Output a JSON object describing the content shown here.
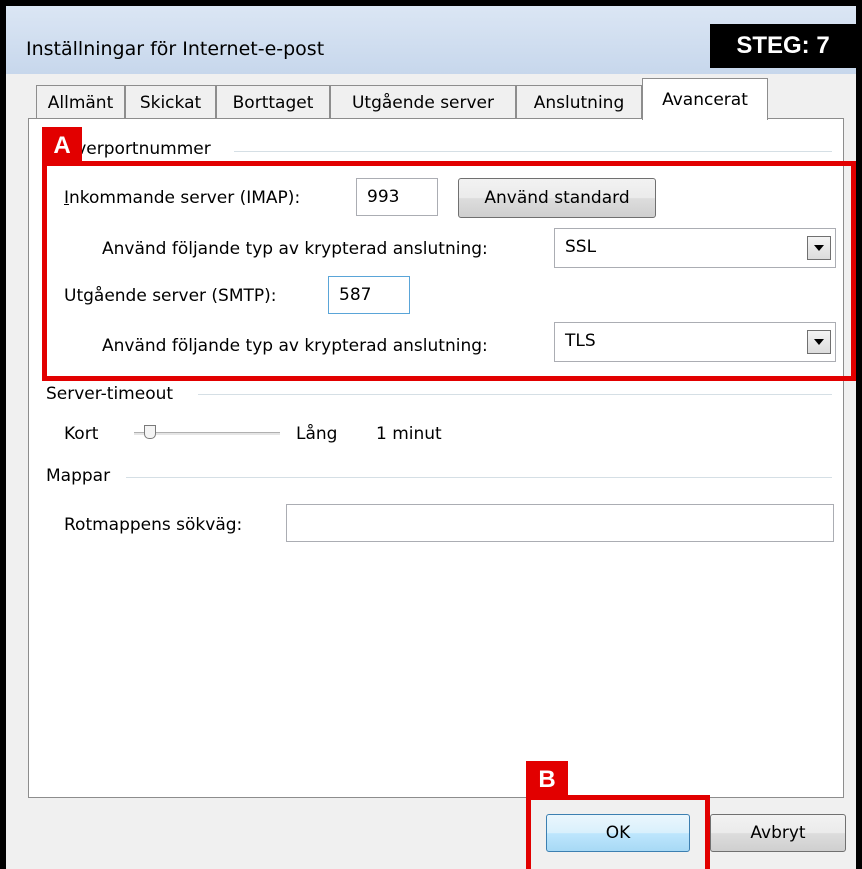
{
  "window": {
    "title": "Inställningar för Internet-e-post",
    "step_badge": "STEG: 7"
  },
  "tabs": [
    {
      "label": "Allmänt",
      "active": false
    },
    {
      "label": "Skickat",
      "active": false
    },
    {
      "label": "Borttaget",
      "active": false
    },
    {
      "label": "Utgående server",
      "active": false
    },
    {
      "label": "Anslutning",
      "active": false
    },
    {
      "label": "Avancerat",
      "active": true
    }
  ],
  "server_ports": {
    "group_label": "Serverportnummer",
    "incoming_label": "Inkommande server (IMAP):",
    "incoming_value": "993",
    "default_button": "Använd standard",
    "incoming_encryption_label": "Använd följande typ av krypterad anslutning:",
    "incoming_encryption_value": "SSL",
    "outgoing_label": "Utgående server (SMTP):",
    "outgoing_value": "587",
    "outgoing_encryption_label": "Använd följande typ av krypterad anslutning:",
    "outgoing_encryption_value": "TLS"
  },
  "server_timeout": {
    "group_label": "Server-timeout",
    "short_label": "Kort",
    "long_label": "Lång",
    "value_text": "1 minut",
    "slider_level": 0.1
  },
  "folders": {
    "group_label": "Mappar",
    "root_path_label": "Rotmappens sökväg:",
    "root_path_value": ""
  },
  "buttons": {
    "ok": "OK",
    "cancel": "Avbryt"
  },
  "annotations": {
    "a": "A",
    "b": "B",
    "color": "#e20000"
  }
}
